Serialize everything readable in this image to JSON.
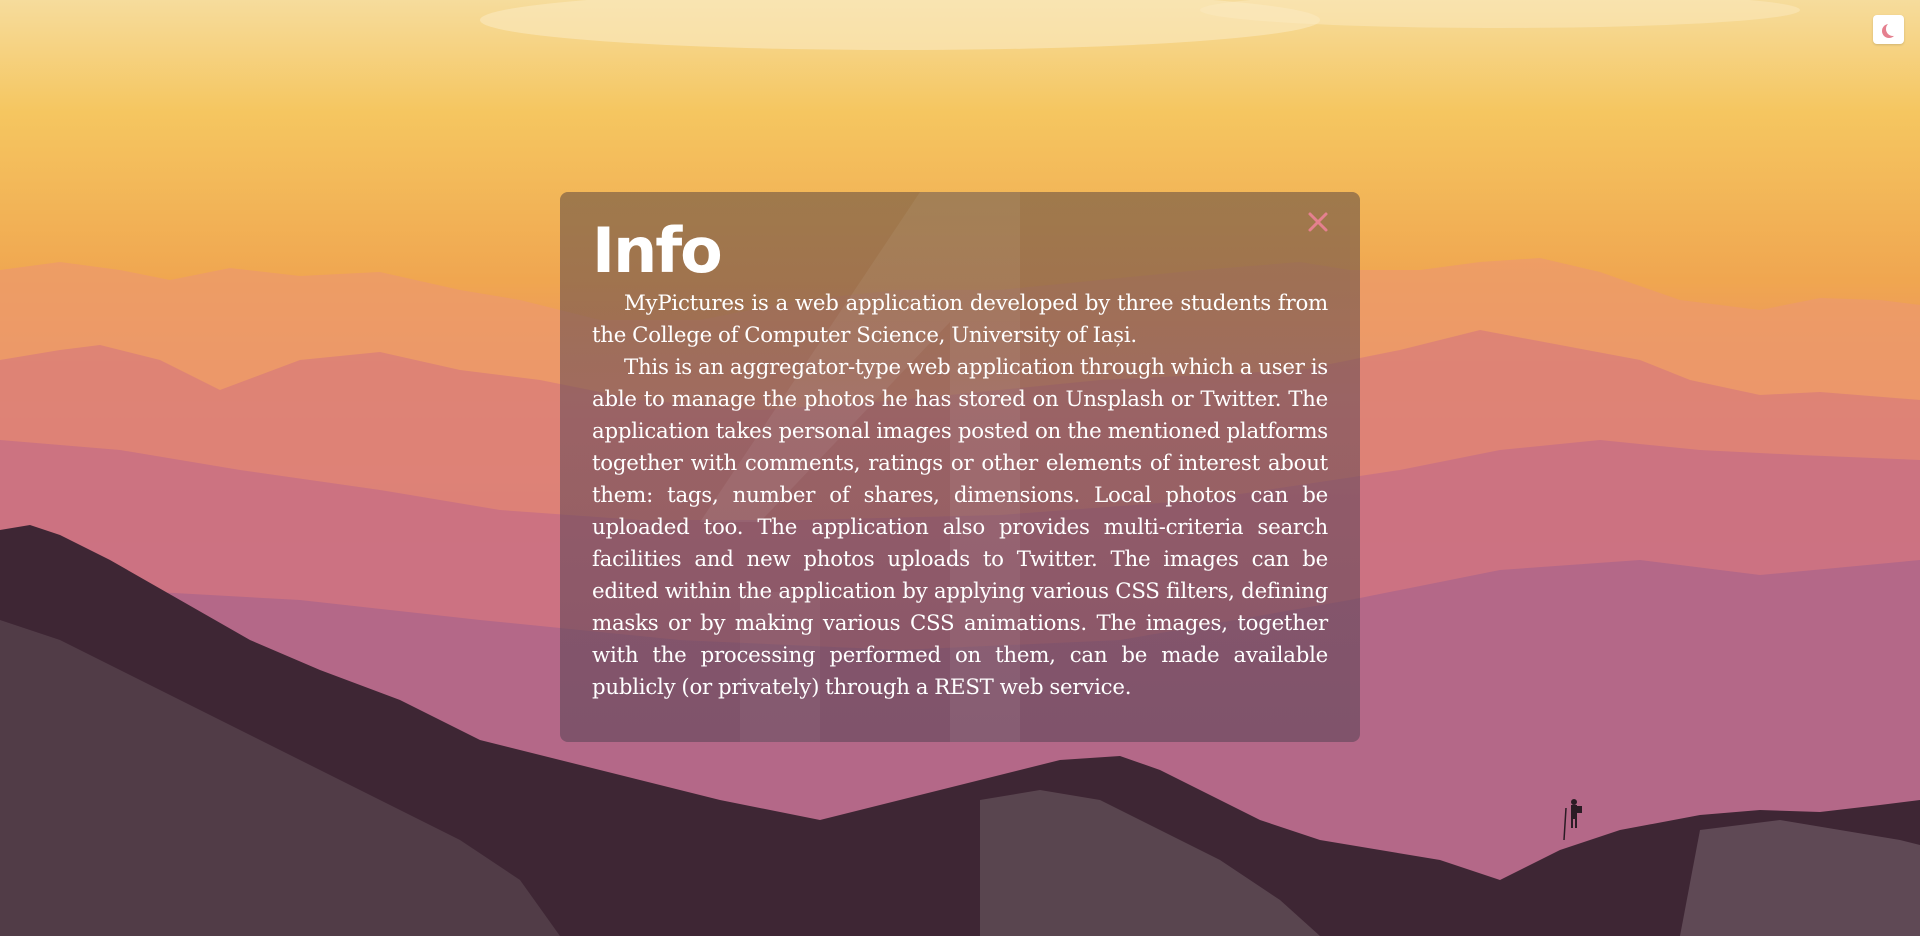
{
  "theme_toggle": {
    "icon": "moon-icon",
    "icon_color": "#e5808f"
  },
  "info_modal": {
    "title": "Info",
    "close_icon": "close-icon",
    "close_color": "#e5808f",
    "paragraphs": [
      "MyPictures is a web application developed by three students from the College of Computer Science, University of Iași.",
      "This is an aggregator-type web application through which a user is able to manage the photos he has stored on Unsplash or Twitter. The application takes personal images posted on the mentioned platforms together with comments, ratings or other elements of interest about them: tags, number of shares, dimensions. Local photos can be uploaded too. The application also provides multi-criteria search facilities and new photos uploads to Twitter. The images can be edited within the application by applying various CSS filters, defining masks or by making various CSS animations. The images, together with the processing performed on them, can be made available publicly (or privately) through a REST web service."
    ]
  }
}
